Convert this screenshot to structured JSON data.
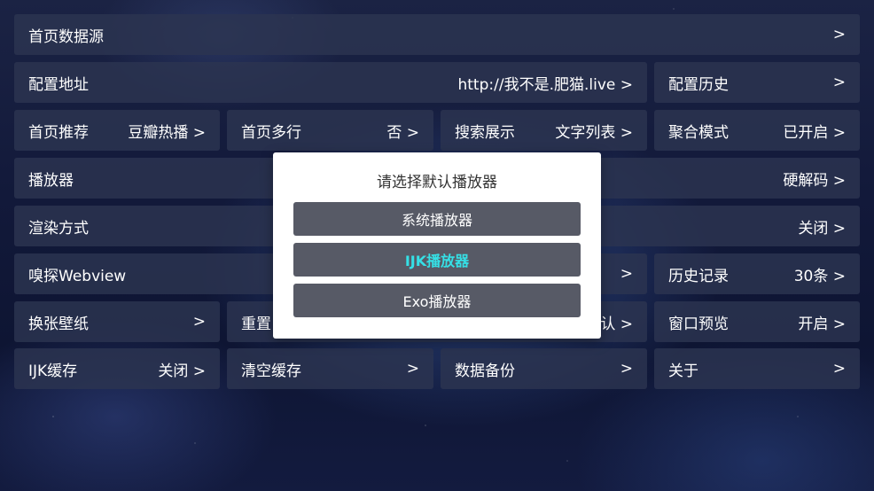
{
  "settings": {
    "home_source": {
      "label": "首页数据源",
      "value": ">"
    },
    "config_url": {
      "label": "配置地址",
      "value": "http://我不是.肥猫.live >"
    },
    "config_history": {
      "label": "配置历史",
      "value": ">"
    },
    "home_recommend": {
      "label": "首页推荐",
      "value": "豆瓣热播 >"
    },
    "home_multirow": {
      "label": "首页多行",
      "value": "否 >"
    },
    "search_display": {
      "label": "搜索展示",
      "value": "文字列表 >"
    },
    "aggregate_mode": {
      "label": "聚合模式",
      "value": "已开启 >"
    },
    "player": {
      "label": "播放器",
      "value": "硬解码 >"
    },
    "render_mode": {
      "label": "渲染方式",
      "value": "关闭 >"
    },
    "sniff_webview": {
      "label": "嗅探Webview",
      "value": ">"
    },
    "history": {
      "label": "历史记录",
      "value": "30条 >"
    },
    "wallpaper": {
      "label": "换张壁纸",
      "value": ">"
    },
    "reset": {
      "label": "重置",
      "value": "认 >"
    },
    "window_preview": {
      "label": "窗口预览",
      "value": "开启 >"
    },
    "ijk_cache": {
      "label": "IJK缓存",
      "value": "关闭 >"
    },
    "clear_cache": {
      "label": "清空缓存",
      "value": ">"
    },
    "data_backup": {
      "label": "数据备份",
      "value": ">"
    },
    "about": {
      "label": "关于",
      "value": ">"
    }
  },
  "dialog": {
    "title": "请选择默认播放器",
    "options": [
      "系统播放器",
      "IJK播放器",
      "Exo播放器"
    ],
    "selected_color": "#35e0e6"
  }
}
